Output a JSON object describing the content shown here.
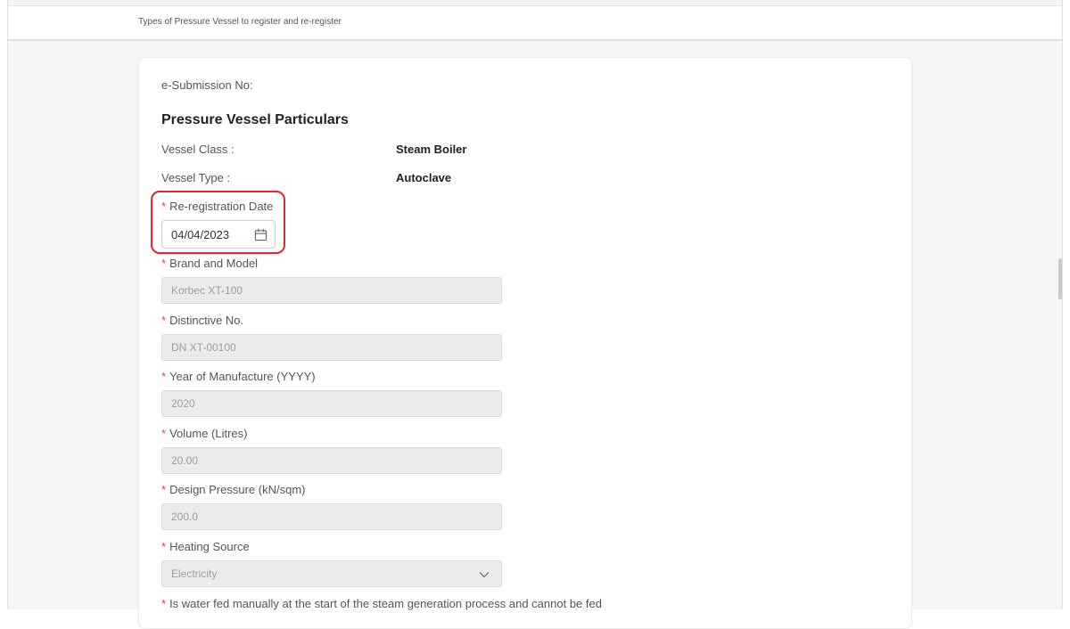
{
  "breadcrumb": "Types of Pressure Vessel to register and re-register",
  "submission_label": "e-Submission No:",
  "section_title": "Pressure Vessel Particulars",
  "vessel_class": {
    "label": "Vessel Class :",
    "value": "Steam Boiler"
  },
  "vessel_type": {
    "label": "Vessel Type :",
    "value": "Autoclave"
  },
  "required_mark": "*",
  "reregistration_date": {
    "label": "Re-registration Date",
    "value": "04/04/2023",
    "icon": "calendar-icon",
    "highlight_color": "#e3262f"
  },
  "brand_model": {
    "label": "Brand and Model",
    "value": "Korbec XT-100"
  },
  "distinctive_no": {
    "label": "Distinctive No.",
    "value": "DN XT-00100"
  },
  "year_of_manufacture": {
    "label": "Year of Manufacture (YYYY)",
    "value": "2020"
  },
  "volume": {
    "label": "Volume (Litres)",
    "value": "20.00"
  },
  "design_pressure": {
    "label": "Design Pressure (kN/sqm)",
    "value": "200.0"
  },
  "heating_source": {
    "label": "Heating Source",
    "value": "Electricity",
    "icon": "chevron-down-icon"
  },
  "water_fed_question": "Is water fed manually at the start of the steam generation process and cannot be fed"
}
